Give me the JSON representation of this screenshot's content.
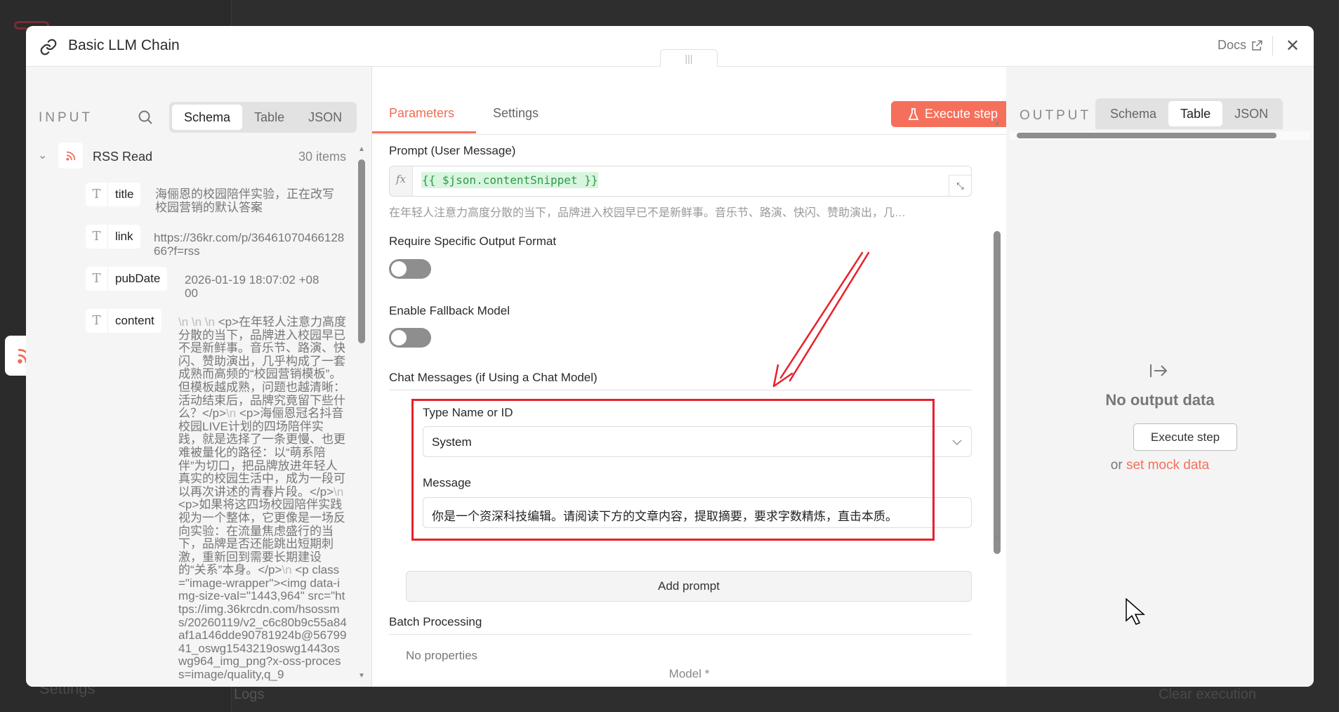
{
  "background": {
    "logs_label": "Logs",
    "clear_execution_label": "Clear execution",
    "settings_label": "Settings"
  },
  "modal": {
    "title": "Basic LLM Chain",
    "docs_label": "Docs"
  },
  "input": {
    "label": "INPUT",
    "tabs": [
      {
        "label": "Schema",
        "active": true
      },
      {
        "label": "Table",
        "active": false
      },
      {
        "label": "JSON",
        "active": false
      }
    ],
    "node_name": "RSS Read",
    "item_count": "30 items",
    "fields": [
      {
        "key": "title",
        "value": "海俪恩的校园陪伴实验，正在改写校园营销的默认答案"
      },
      {
        "key": "link",
        "value": "https://36kr.com/p/3646107046612866?f=rss"
      },
      {
        "key": "pubDate",
        "value": "2026-01-19 18:07:02 +0800"
      },
      {
        "key": "content",
        "segments": [
          {
            "text": "\\n \\n \\n ",
            "muted": true
          },
          {
            "text": "<p>在年轻人注意力高度分散的当下，品牌进入校园早已不是新鲜事。音乐节、路演、快闪、赞助演出，几乎构成了一套成熟而高频的“校园营销模板”。但模板越成熟，问题也越清晰：活动结束后，品牌究竟留下些什么？</p>",
            "muted": false
          },
          {
            "text": "\\n ",
            "muted": true
          },
          {
            "text": "<p>海俪恩冠名抖音校园LIVE计划的四场陪伴实践，就是选择了一条更慢、也更难被量化的路径：以“萌系陪伴”为切口，把品牌放进年轻人真实的校园生活中，成为一段可以再次讲述的青春片段。</p>",
            "muted": false
          },
          {
            "text": "\\n ",
            "muted": true
          },
          {
            "text": "<p>如果将这四场校园陪伴实践视为一个整体，它更像是一场反向实验：在流量焦虑盛行的当下，品牌是否还能跳出短期刺激，重新回到需要长期建设的“关系”本身。</p>",
            "muted": false
          },
          {
            "text": "\\n ",
            "muted": true
          },
          {
            "text": "<p class=\"image-wrapper\"><img data-img-size-val=\"1443,964\" src=\"https://img.36krcdn.com/hsossms/20260119/v2_c6c80b9c55a84af1a146dde90781924b@5679941_oswg1543219oswg1443oswg964_img_png?x-oss-process=image/quality,q_9",
            "muted": false
          }
        ]
      }
    ]
  },
  "params": {
    "tabs": [
      {
        "label": "Parameters",
        "active": true
      },
      {
        "label": "Settings",
        "active": false
      }
    ],
    "execute_label": "Execute step",
    "prompt_label": "Prompt (User Message)",
    "prompt_expression": "{{ $json.contentSnippet }}",
    "prompt_preview": "在年轻人注意力高度分散的当下，品牌进入校园早已不是新鲜事。音乐节、路演、快闪、赞助演出，几…",
    "require_format_label": "Require Specific Output Format",
    "require_format_on": false,
    "fallback_label": "Enable Fallback Model",
    "fallback_on": false,
    "chat_messages_label": "Chat Messages (if Using a Chat Model)",
    "type_label": "Type Name or ID",
    "type_value": "System",
    "message_label": "Message",
    "message_value": "你是一个资深科技编辑。请阅读下方的文章内容，提取摘要，要求字数精炼，直击本质。",
    "add_prompt_label": "Add prompt",
    "batch_label": "Batch Processing",
    "no_properties": "No properties",
    "model_label": "Model *"
  },
  "output": {
    "label": "OUTPUT",
    "tabs": [
      {
        "label": "Schema",
        "active": false
      },
      {
        "label": "Table",
        "active": true
      },
      {
        "label": "JSON",
        "active": false
      }
    ],
    "empty_title": "No output data",
    "execute_label": "Execute step",
    "or_label": "or",
    "mock_label": "set mock data"
  },
  "colors": {
    "accent": "#f5705c",
    "annotation": "#e8202a",
    "expression_bg": "#d8f5df",
    "expression_text": "#2e9a48"
  }
}
